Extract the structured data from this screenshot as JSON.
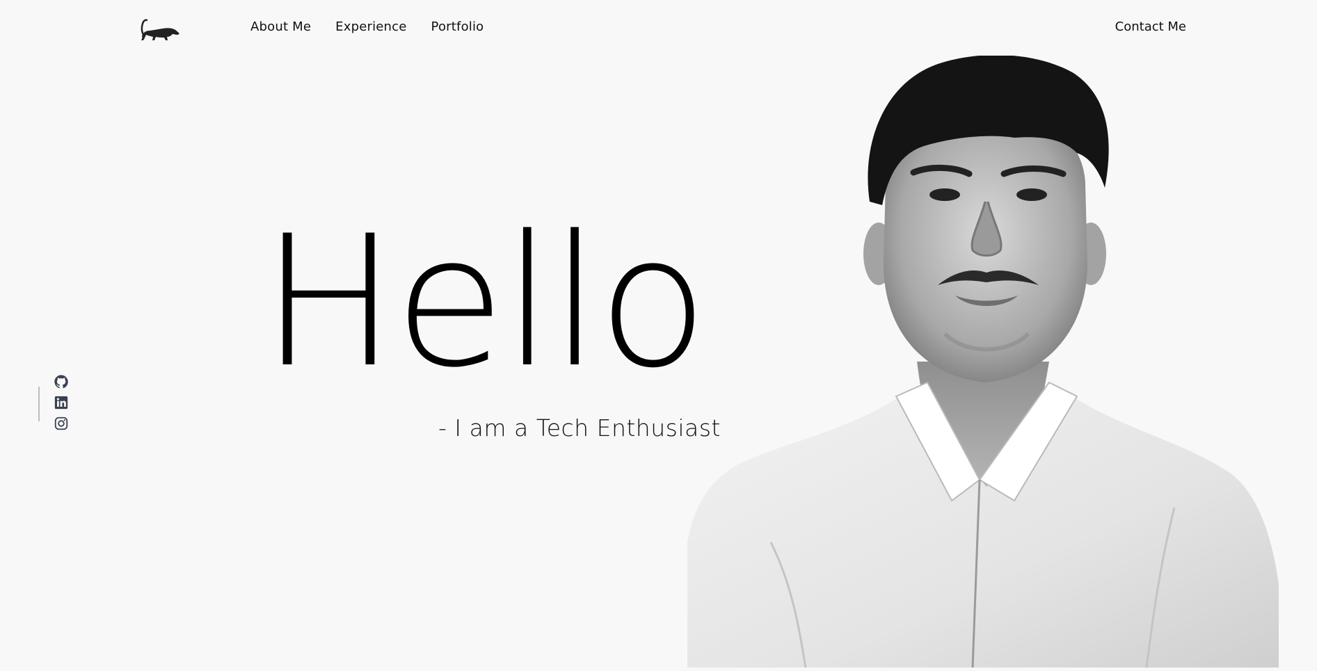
{
  "header": {
    "logo_icon": "panther-logo-icon",
    "nav": [
      {
        "label": "About Me"
      },
      {
        "label": "Experience"
      },
      {
        "label": "Portfolio"
      }
    ],
    "contact_label": "Contact Me"
  },
  "hero": {
    "headline": "Hello",
    "tagline": "- I am a Tech Enthusiast"
  },
  "social": [
    {
      "icon": "github-icon"
    },
    {
      "icon": "linkedin-icon"
    },
    {
      "icon": "instagram-icon"
    }
  ],
  "colors": {
    "background": "#f8f8f8",
    "text": "#000000",
    "social_icon": "#3a4150",
    "divider": "#b8bdc6"
  }
}
